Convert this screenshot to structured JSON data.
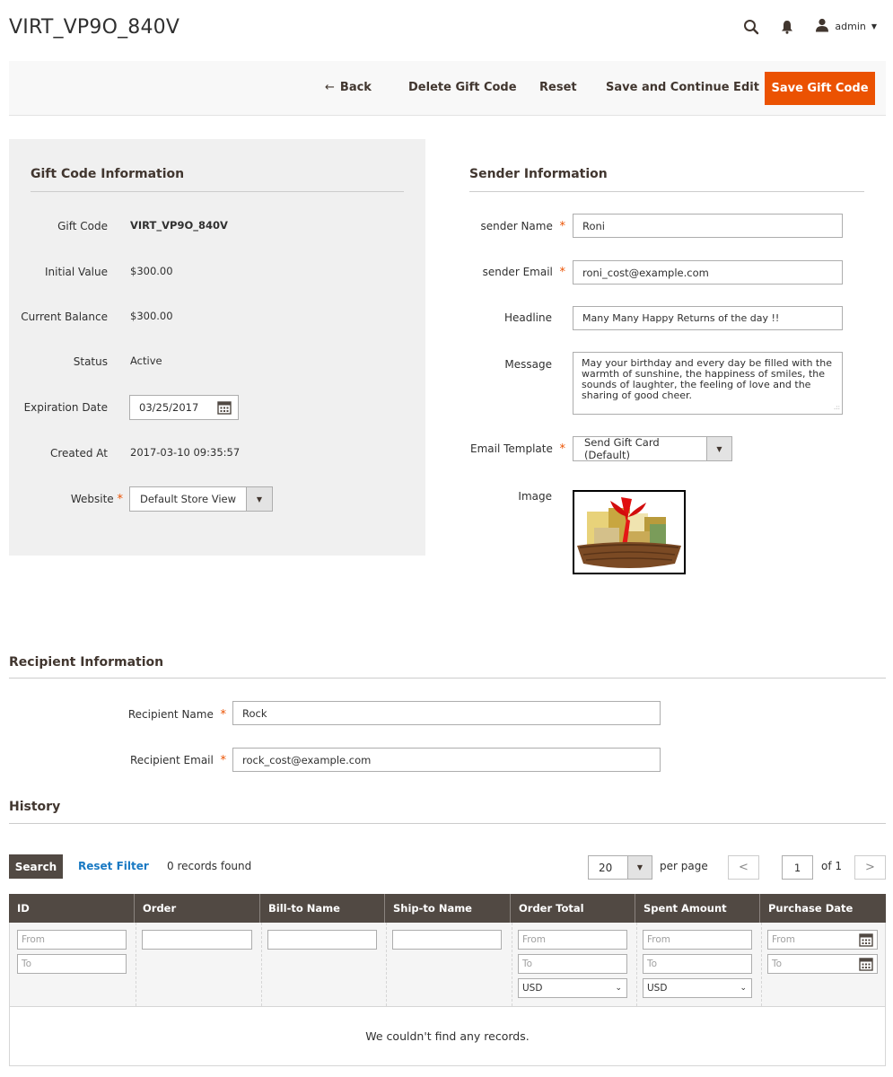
{
  "page_title": "VIRT_VP9O_840V",
  "header": {
    "admin_label": "admin"
  },
  "toolbar": {
    "back_label": "Back",
    "delete_label": "Delete Gift Code",
    "reset_label": "Reset",
    "save_continue_label": "Save and Continue Edit",
    "save_label": "Save Gift Code",
    "save_color": "#eb5202"
  },
  "gift_info": {
    "title": "Gift Code Information",
    "gift_code_label": "Gift Code",
    "gift_code_value": "VIRT_VP9O_840V",
    "initial_value_label": "Initial Value",
    "initial_value": "$300.00",
    "current_balance_label": "Current Balance",
    "current_balance": "$300.00",
    "status_label": "Status",
    "status_value": "Active",
    "expiration_label": "Expiration Date",
    "expiration_value": "03/25/2017",
    "created_label": "Created At",
    "created_value": "2017-03-10 09:35:57",
    "website_label": "Website",
    "website_value": "Default Store View"
  },
  "sender_info": {
    "title": "Sender Information",
    "name_label": "sender Name",
    "name_value": "Roni",
    "email_label": "sender Email",
    "email_value": "roni_cost@example.com",
    "headline_label": "Headline",
    "headline_value": "Many Many Happy Returns of the day !!",
    "message_label": "Message",
    "message_value": "May your birthday and every day be filled with the warmth of sunshine, the happiness of smiles, the sounds of laughter, the feeling of love and the sharing of good cheer.",
    "template_label": "Email Template",
    "template_value": "Send Gift Card (Default)",
    "image_label": "Image"
  },
  "recipient_info": {
    "title": "Recipient Information",
    "name_label": "Recipient Name",
    "name_value": "Rock",
    "email_label": "Recipient Email",
    "email_value": "rock_cost@example.com"
  },
  "history": {
    "title": "History",
    "search_label": "Search",
    "reset_filter_label": "Reset Filter",
    "records_found": "0 records found",
    "per_page_value": "20",
    "per_page_label": "per page",
    "page_current": "1",
    "page_total": "of 1",
    "columns": [
      "ID",
      "Order",
      "Bill-to Name",
      "Ship-to Name",
      "Order Total",
      "Spent Amount",
      "Purchase Date"
    ],
    "from_placeholder": "From",
    "to_placeholder": "To",
    "currency_value": "USD",
    "empty_message": "We couldn't find any records."
  }
}
